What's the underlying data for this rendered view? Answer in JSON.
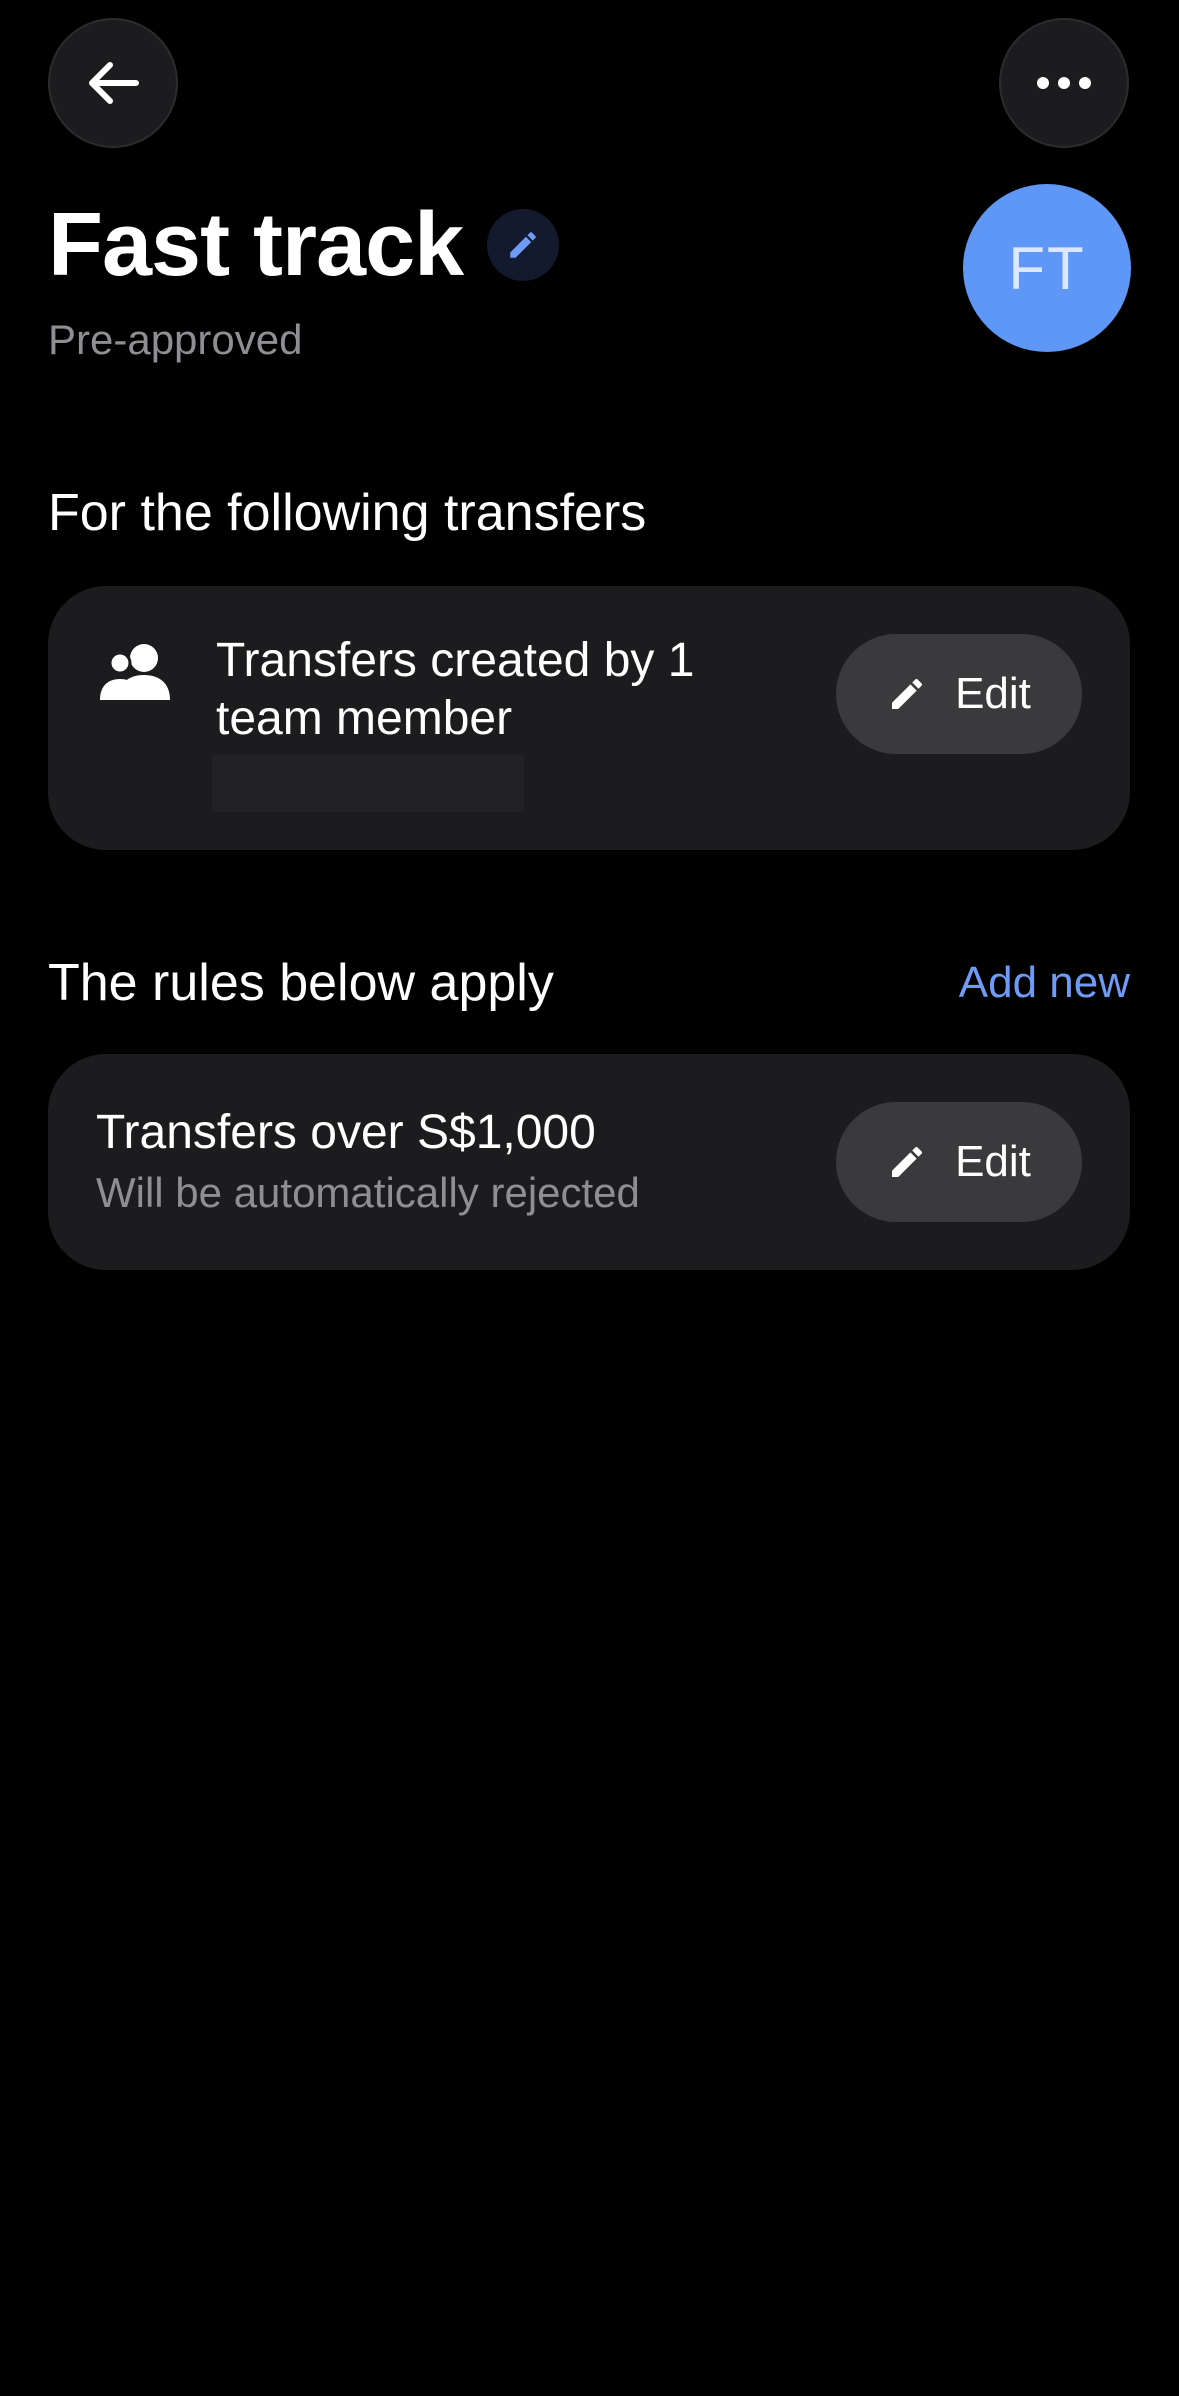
{
  "header": {
    "back_icon": "arrow-left-icon",
    "more_icon": "more-horizontal-icon"
  },
  "policy": {
    "title": "Fast track",
    "edit_icon": "pencil-icon",
    "status": "Pre-approved",
    "avatar_initials": "FT",
    "avatar_color": "#5e97f6"
  },
  "transfers_section": {
    "title": "For the following transfers",
    "card": {
      "icon": "team-icon",
      "text": "Transfers created by 1 team member",
      "edit_label": "Edit"
    }
  },
  "rules_section": {
    "title": "The rules below apply",
    "add_new_label": "Add new",
    "rules": [
      {
        "title": "Transfers over S$1,000",
        "subtitle": "Will be automatically rejected",
        "edit_label": "Edit"
      }
    ]
  },
  "colors": {
    "background": "#000000",
    "card": "#1c1c1e",
    "button": "#3a3a3c",
    "accent": "#6f9af5",
    "muted_text": "#8e8e93"
  }
}
